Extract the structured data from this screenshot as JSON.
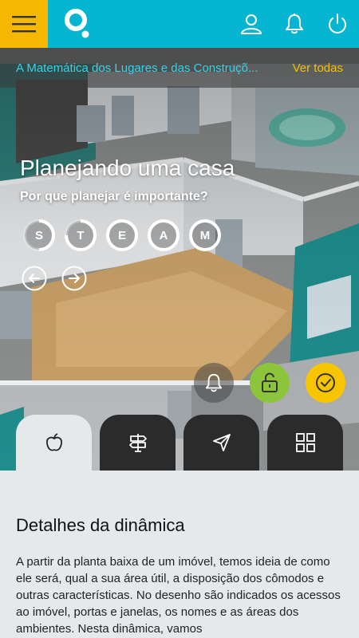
{
  "header": {
    "menu_icon": "hamburger-icon",
    "logo_icon": "app-logo-icon",
    "actions": [
      "user-icon",
      "bell-icon",
      "power-icon"
    ]
  },
  "subbar": {
    "crumb": "A Matemática dos Lugares e das Construçõ...",
    "see_all": "Ver todas"
  },
  "hero": {
    "title": "Planejando uma casa",
    "subtitle": "Por que planejar é importante?",
    "steam": [
      {
        "letter": "S",
        "progress": 0.5
      },
      {
        "letter": "T",
        "progress": 0.75
      },
      {
        "letter": "E",
        "progress": 1.0
      },
      {
        "letter": "A",
        "progress": 1.0
      },
      {
        "letter": "M",
        "progress": 1.0
      }
    ],
    "arrows": [
      "arrow-left-icon",
      "arrow-right-icon"
    ],
    "fabs": [
      "bell-icon",
      "unlock-icon",
      "check-icon"
    ]
  },
  "tabs": [
    {
      "icon": "apple-icon",
      "active": true
    },
    {
      "icon": "signpost-icon",
      "active": false
    },
    {
      "icon": "send-icon",
      "active": false
    },
    {
      "icon": "grid-icon",
      "active": false
    }
  ],
  "colors": {
    "header": "#06b6d0",
    "menu": "#f5b700",
    "crumb": "#34d2e8",
    "see_all": "#f5c000",
    "unlock": "#8cc43c",
    "check": "#f7c400"
  },
  "details": {
    "title": "Detalhes da dinâmica",
    "body": "A partir da planta baixa de um imóvel, temos ideia de como ele será, qual a sua área útil, a disposição dos cômodos e outras características. No desenho são indicados os acessos ao imóvel, portas e janelas, os nomes e as áreas dos ambientes. Nesta dinâmica, vamos"
  }
}
